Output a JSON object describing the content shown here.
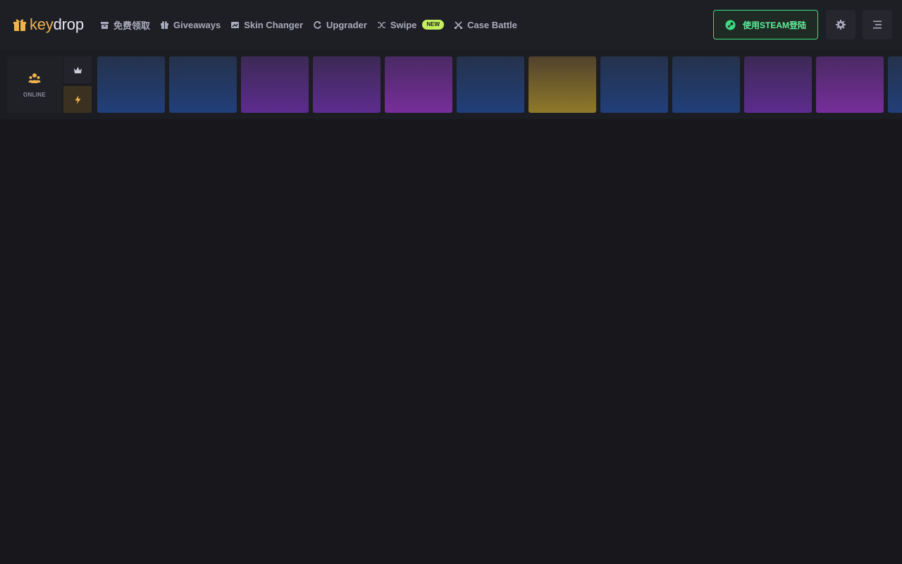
{
  "brand": {
    "name_left": "key",
    "name_right": "drop"
  },
  "nav": [
    {
      "label": "免费领取",
      "icon": "box-icon"
    },
    {
      "label": "Giveaways",
      "icon": "gift-icon"
    },
    {
      "label": "Skin Changer",
      "icon": "image-swap-icon"
    },
    {
      "label": "Upgrader",
      "icon": "refresh-icon"
    },
    {
      "label": "Swipe",
      "icon": "shuffle-icon",
      "badge": "NEW"
    },
    {
      "label": "Case Battle",
      "icon": "crossed-swords-icon"
    }
  ],
  "login": {
    "label": "使用STEAM登陆",
    "icon": "steam-icon"
  },
  "drops": {
    "online_label": "ONLINE",
    "tiles": [
      "blue",
      "blue",
      "purple",
      "purple",
      "pink",
      "blue",
      "gold",
      "blue",
      "blue",
      "purple",
      "pink",
      "blue"
    ]
  },
  "colors": {
    "accent": "#f0b24a",
    "steam_green": "#3ddc84",
    "new_badge": "#c4f05d",
    "bg": "#18181c",
    "header_bg": "#1e1f24"
  }
}
